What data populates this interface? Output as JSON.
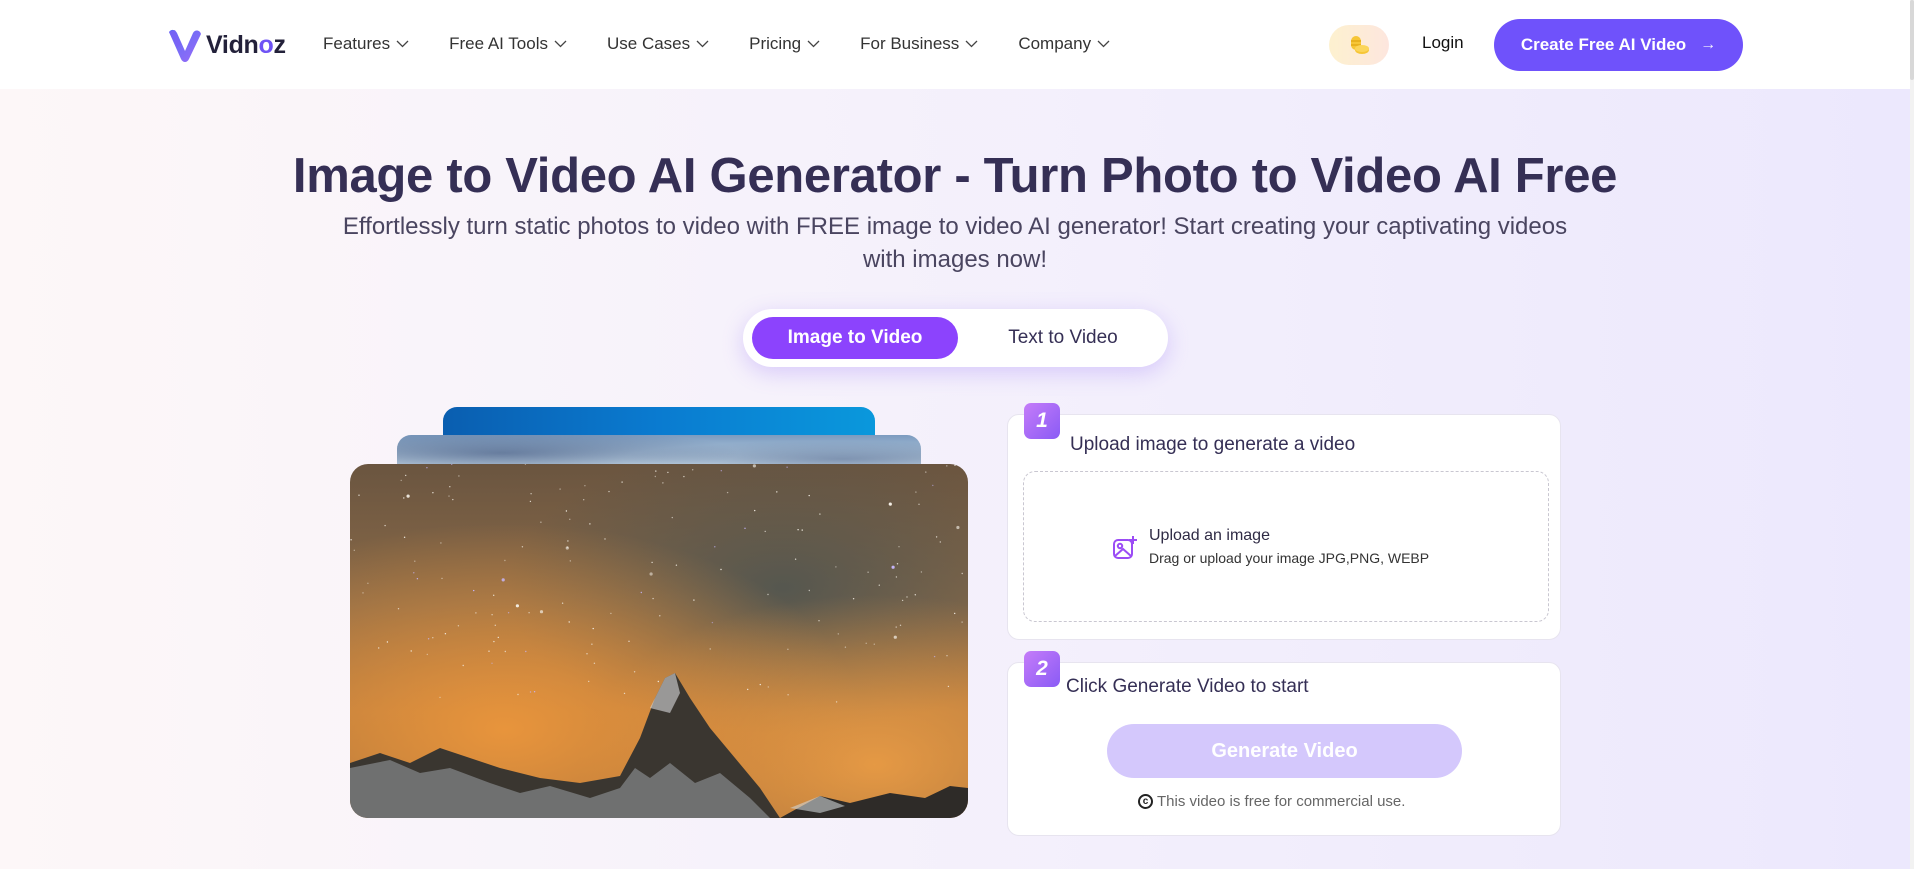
{
  "header": {
    "logo_text_a": "Vidn",
    "logo_text_o": "o",
    "logo_text_b": "z",
    "nav": [
      {
        "label": "Features",
        "icon": "chevron-down-icon"
      },
      {
        "label": "Free AI Tools",
        "icon": "chevron-down-icon"
      },
      {
        "label": "Use Cases",
        "icon": "chevron-down-icon"
      },
      {
        "label": "Pricing",
        "icon": "chevron-down-icon"
      },
      {
        "label": "For Business",
        "icon": "chevron-down-icon"
      },
      {
        "label": "Company",
        "icon": "chevron-down-icon"
      }
    ],
    "coin_icon": "coins-icon",
    "login_label": "Login",
    "cta_label": "Create Free AI Video",
    "cta_arrow": "→"
  },
  "hero": {
    "title": "Image to Video AI Generator - Turn Photo to Video AI Free",
    "subtitle": "Effortlessly turn static photos to video with FREE image to video AI generator! Start creating your captivating videos with images now!"
  },
  "mode_tabs": [
    {
      "label": "Image to Video",
      "active": true
    },
    {
      "label": "Text to Video",
      "active": false
    }
  ],
  "steps": {
    "step1": {
      "number": "1",
      "title": "Upload image to generate a video",
      "upload_label": "Upload an image",
      "upload_hint": "Drag or upload your image JPG,PNG, WEBP",
      "icon": "image-add-icon"
    },
    "step2": {
      "number": "2",
      "title": "Click Generate Video to start",
      "button_label": "Generate Video",
      "note_icon": "©",
      "note": "This video is free for commercial use."
    }
  },
  "colors": {
    "brand_primary": "#6f52fb",
    "tab_active": "#8c43fd",
    "text_dark": "#352f55",
    "generate_disabled": "#d4c8fc"
  }
}
